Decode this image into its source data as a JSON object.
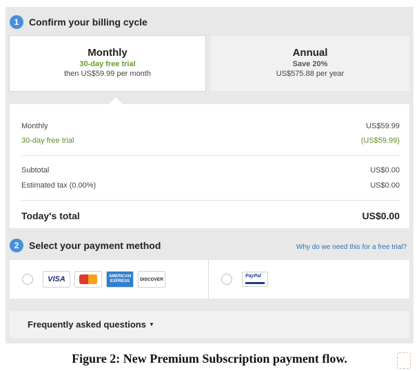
{
  "step1": {
    "number": "1",
    "title": "Confirm your billing cycle"
  },
  "billing": {
    "monthly": {
      "name": "Monthly",
      "promo": "30-day free trial",
      "price": "then US$59.99 per month"
    },
    "annual": {
      "name": "Annual",
      "promo": "Save 20%",
      "price": "US$575.88 per year"
    }
  },
  "summary": {
    "rows": [
      {
        "label": "Monthly",
        "value": "US$59.99"
      },
      {
        "label": "30-day free trial",
        "value": "(US$59.99)"
      },
      {
        "label": "Subtotal",
        "value": "US$0.00"
      },
      {
        "label": "Estimated tax (0.00%)",
        "value": "US$0.00"
      }
    ],
    "total": {
      "label": "Today's total",
      "value": "US$0.00"
    }
  },
  "step2": {
    "number": "2",
    "title": "Select your payment method",
    "link": "Why do we need this for a free trial?"
  },
  "payment": {
    "visa": "VISA",
    "amex": "AMERICAN EXPRESS",
    "discover": "DISCOVER",
    "paypal": "PayPal"
  },
  "faq": {
    "label": "Frequently asked questions"
  },
  "caption": "Figure 2: New Premium Subscription payment flow.",
  "colors": {
    "accent_blue": "#4a90d9",
    "trial_green": "#6a9a2f",
    "link_blue": "#2f6fb6"
  }
}
